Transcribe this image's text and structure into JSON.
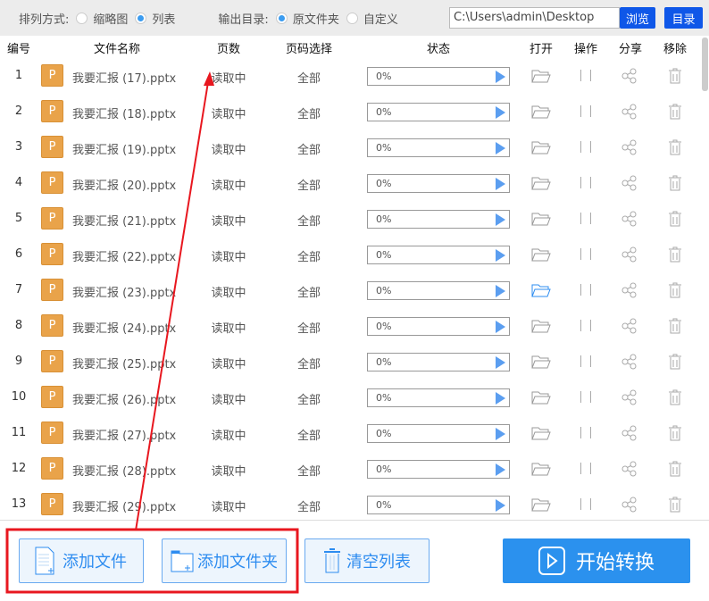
{
  "toolbar": {
    "sort_label": "排列方式:",
    "sort_options": [
      "缩略图",
      "列表"
    ],
    "sort_selected": "列表",
    "output_label": "输出目录:",
    "output_options": [
      "原文件夹",
      "自定义"
    ],
    "output_selected": "原文件夹",
    "path_value": "C:\\Users\\admin\\Desktop",
    "browse_label": "浏览",
    "dir_label": "目录"
  },
  "columns": [
    "编号",
    "文件名称",
    "页数",
    "页码选择",
    "状态",
    "打开",
    "操作",
    "分享",
    "移除"
  ],
  "rows": [
    {
      "num": "1",
      "icon": "P",
      "name": "我要汇报 (17).pptx",
      "pages": "读取中",
      "range": "全部",
      "progress": "0%"
    },
    {
      "num": "2",
      "icon": "P",
      "name": "我要汇报 (18).pptx",
      "pages": "读取中",
      "range": "全部",
      "progress": "0%"
    },
    {
      "num": "3",
      "icon": "P",
      "name": "我要汇报 (19).pptx",
      "pages": "读取中",
      "range": "全部",
      "progress": "0%"
    },
    {
      "num": "4",
      "icon": "P",
      "name": "我要汇报 (20).pptx",
      "pages": "读取中",
      "range": "全部",
      "progress": "0%"
    },
    {
      "num": "5",
      "icon": "P",
      "name": "我要汇报 (21).pptx",
      "pages": "读取中",
      "range": "全部",
      "progress": "0%"
    },
    {
      "num": "6",
      "icon": "P",
      "name": "我要汇报 (22).pptx",
      "pages": "读取中",
      "range": "全部",
      "progress": "0%"
    },
    {
      "num": "7",
      "icon": "P",
      "name": "我要汇报 (23).pptx",
      "pages": "读取中",
      "range": "全部",
      "progress": "0%"
    },
    {
      "num": "8",
      "icon": "P",
      "name": "我要汇报 (24).pptx",
      "pages": "读取中",
      "range": "全部",
      "progress": "0%"
    },
    {
      "num": "9",
      "icon": "P",
      "name": "我要汇报 (25).pptx",
      "pages": "读取中",
      "range": "全部",
      "progress": "0%"
    },
    {
      "num": "10",
      "icon": "P",
      "name": "我要汇报 (26).pptx",
      "pages": "读取中",
      "range": "全部",
      "progress": "0%"
    },
    {
      "num": "11",
      "icon": "P",
      "name": "我要汇报 (27).pptx",
      "pages": "读取中",
      "range": "全部",
      "progress": "0%"
    },
    {
      "num": "12",
      "icon": "P",
      "name": "我要汇报 (28).pptx",
      "pages": "读取中",
      "range": "全部",
      "progress": "0%"
    },
    {
      "num": "13",
      "icon": "P",
      "name": "我要汇报 (29).pptx",
      "pages": "读取中",
      "range": "全部",
      "progress": "0%"
    }
  ],
  "bottom": {
    "add_file": "添加文件",
    "add_folder": "添加文件夹",
    "clear_list": "清空列表",
    "start": "开始转换"
  },
  "colors": {
    "accent": "#2b91ee",
    "file_icon": "#e9a34a",
    "annotation": "#e8171f"
  }
}
